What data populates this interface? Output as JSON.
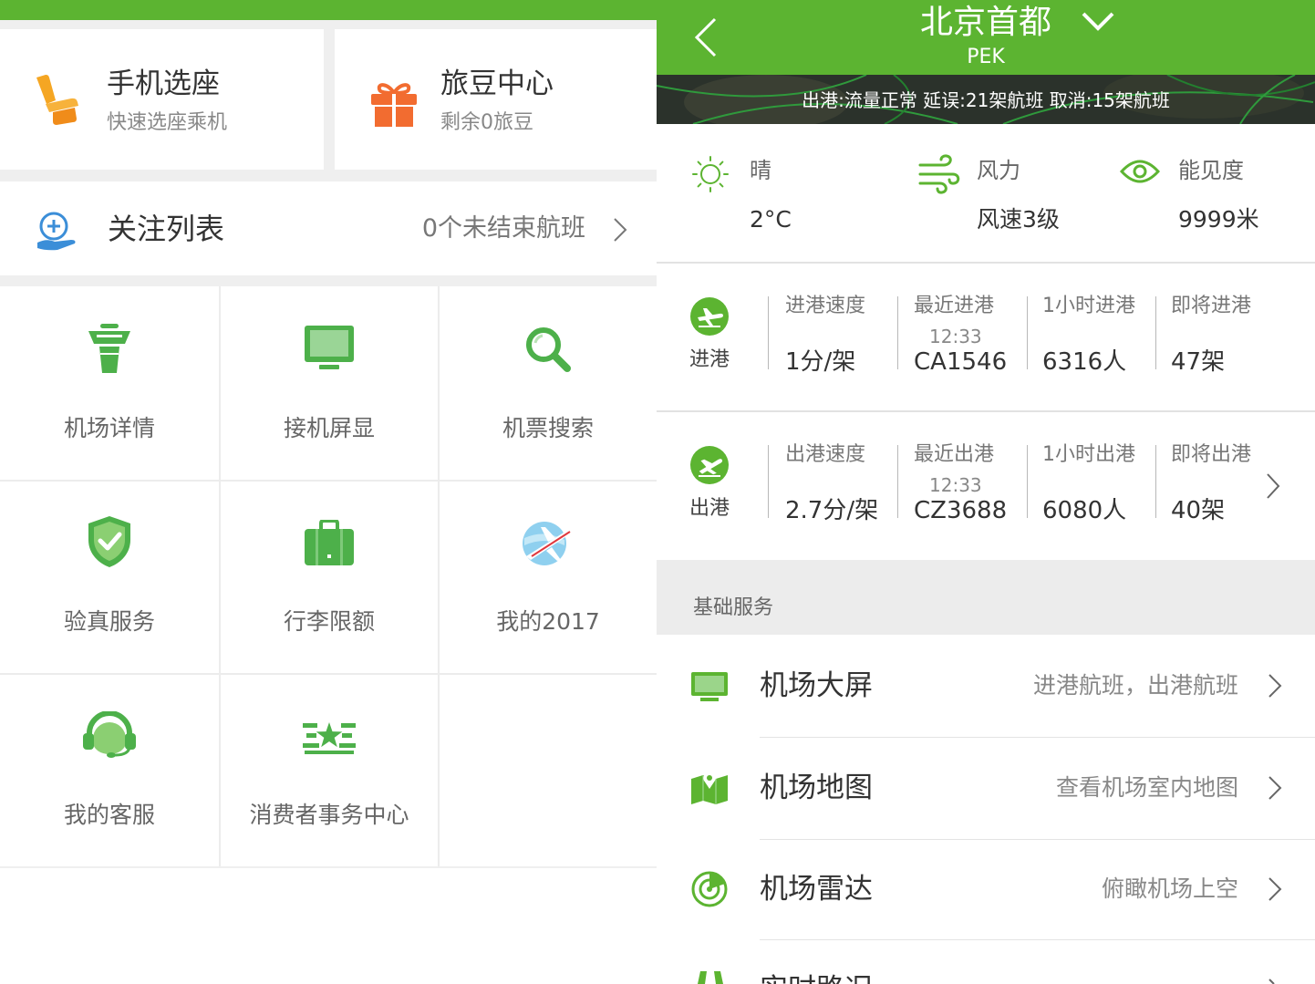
{
  "colors": {
    "brand_green": "#5cb431",
    "icon_green": "#4db04a",
    "seat_orange": "#f5a623",
    "gift_orange": "#f26c30",
    "watchlist_blue": "#3b8ed8",
    "banner_dark": "#2b322b"
  },
  "left": {
    "seat_card": {
      "title": "手机选座",
      "subtitle": "快速选座乘机",
      "icon": "seat-icon"
    },
    "bean_card": {
      "title": "旅豆中心",
      "subtitle": "剩余0旅豆",
      "icon": "gift-icon"
    },
    "watchlist": {
      "title": "关注列表",
      "status": "0个未结束航班",
      "icon": "watchlist-icon"
    },
    "grid": [
      {
        "label": "机场详情",
        "icon": "control-tower-icon"
      },
      {
        "label": "接机屏显",
        "icon": "monitor-icon"
      },
      {
        "label": "机票搜索",
        "icon": "search-icon"
      },
      {
        "label": "验真服务",
        "icon": "shield-check-icon"
      },
      {
        "label": "行李限额",
        "icon": "luggage-icon"
      },
      {
        "label": "我的2017",
        "icon": "globe-plane-icon"
      },
      {
        "label": "我的客服",
        "icon": "headset-icon"
      },
      {
        "label": "消费者事务中心",
        "icon": "consumer-emblem-icon"
      }
    ]
  },
  "right": {
    "header": {
      "title": "北京首都",
      "code": "PEK"
    },
    "banner": "出港:流量正常 延误:21架航班 取消:15架航班",
    "weather": {
      "condition": {
        "label": "晴",
        "value": "2°C",
        "icon": "sun-icon"
      },
      "wind": {
        "label": "风力",
        "value": "风速3级",
        "icon": "wind-icon"
      },
      "visibility": {
        "label": "能见度",
        "value": "9999米",
        "icon": "eye-icon"
      }
    },
    "arrivals": {
      "label": "进港",
      "stats": [
        {
          "label": "进港速度",
          "value": "1分/架"
        },
        {
          "label": "最近进港",
          "time": "12:33",
          "value": "CA1546"
        },
        {
          "label": "1小时进港",
          "value": "6316人"
        },
        {
          "label": "即将进港",
          "value": "47架"
        }
      ]
    },
    "departures": {
      "label": "出港",
      "stats": [
        {
          "label": "出港速度",
          "value": "2.7分/架"
        },
        {
          "label": "最近出港",
          "time": "12:33",
          "value": "CZ3688"
        },
        {
          "label": "1小时出港",
          "value": "6080人"
        },
        {
          "label": "即将出港",
          "value": "40架"
        }
      ]
    },
    "section_title": "基础服务",
    "services": [
      {
        "title": "机场大屏",
        "desc": "进港航班，出港航班",
        "icon": "monitor-icon"
      },
      {
        "title": "机场地图",
        "desc": "查看机场室内地图",
        "icon": "map-icon"
      },
      {
        "title": "机场雷达",
        "desc": "俯瞰机场上空",
        "icon": "radar-icon"
      },
      {
        "title": "实时路况",
        "icon": "road-icon"
      }
    ]
  }
}
